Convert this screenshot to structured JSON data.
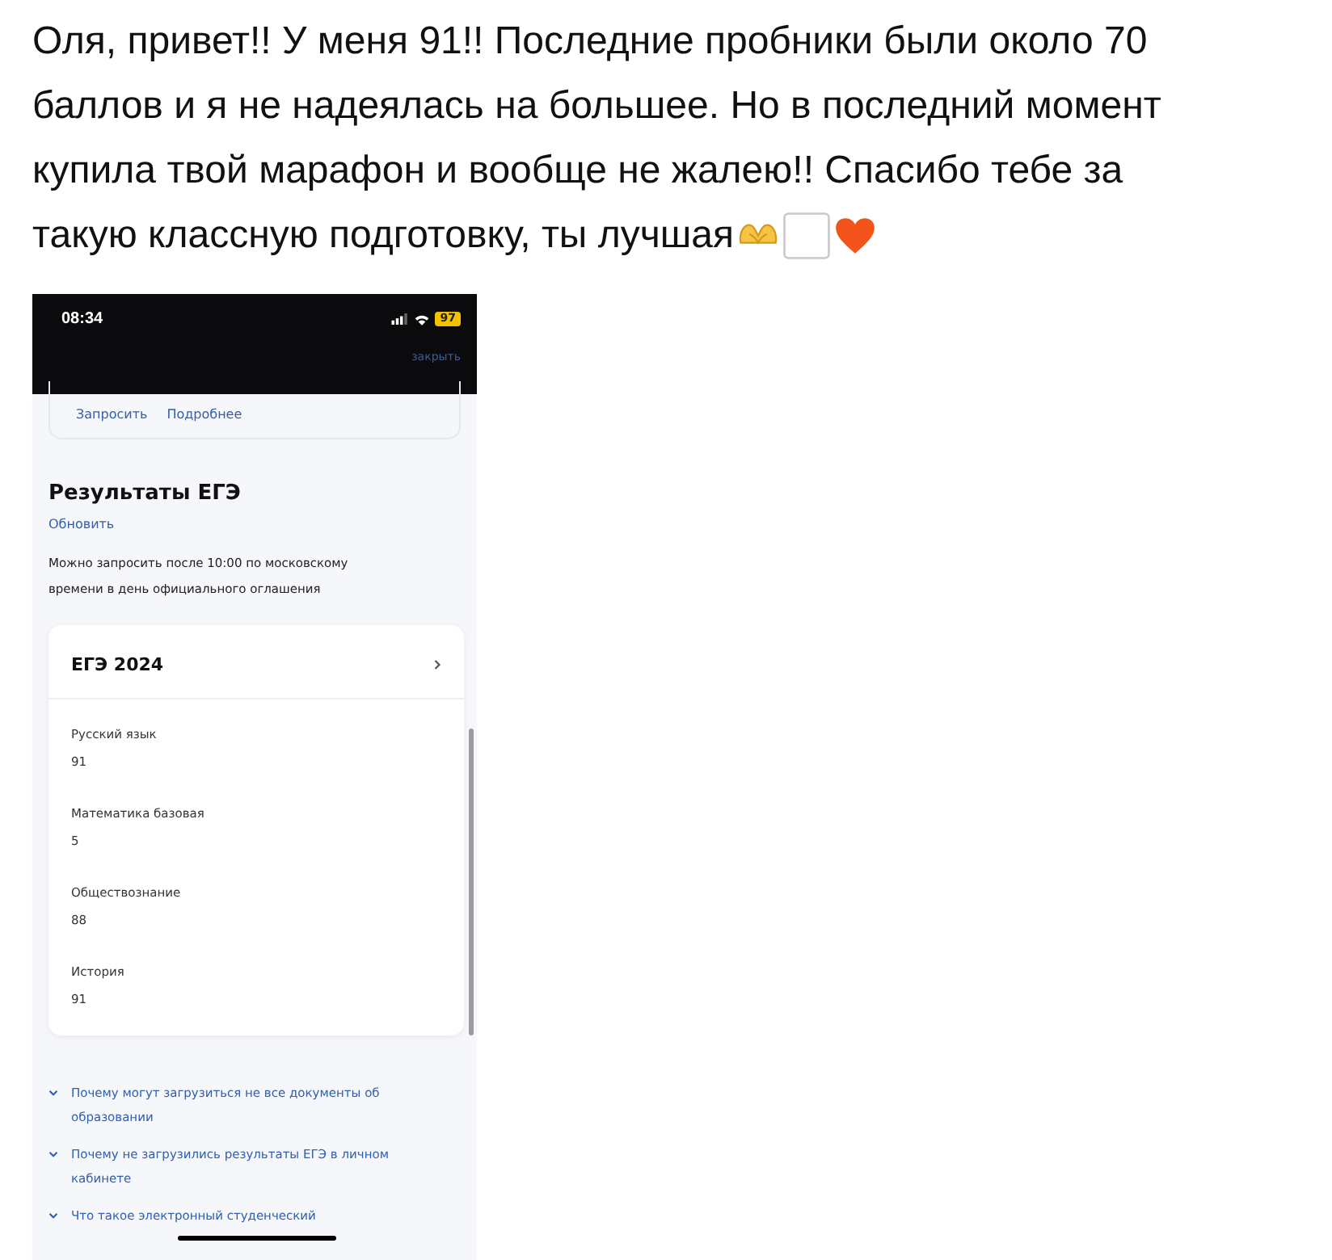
{
  "message": {
    "lines": [
      "Оля, привет!! У меня 91!! Последние пробники были около 70",
      "баллов и я не надеялась на большее. Но в последний момент",
      "купила твой марафон и вообще не жалею!! Спасибо тебе за",
      "такую классную подготовку, ты лучшая"
    ]
  },
  "phone": {
    "status_bar": {
      "time": "08:34",
      "battery": "97"
    },
    "close_link": "закрыть",
    "actions": [
      "Запросить",
      "Подробнее"
    ],
    "section": {
      "title": "Результаты ЕГЭ",
      "refresh": "Обновить",
      "note": "Можно запросить после 10:00 по московскому времени в день официального оглашения"
    },
    "exam_card": {
      "title": "ЕГЭ 2024",
      "results": [
        {
          "subject": "Русский язык",
          "score": "91"
        },
        {
          "subject": "Математика базовая",
          "score": "5"
        },
        {
          "subject": "Обществознание",
          "score": "88"
        },
        {
          "subject": "История",
          "score": "91"
        }
      ]
    },
    "faq": [
      {
        "question": "Почему могут загрузиться не все документы об образовании"
      },
      {
        "question": "Почему не загрузились результаты ЕГЭ в личном кабинете"
      },
      {
        "question": "Что такое электронный студенческий"
      }
    ]
  }
}
